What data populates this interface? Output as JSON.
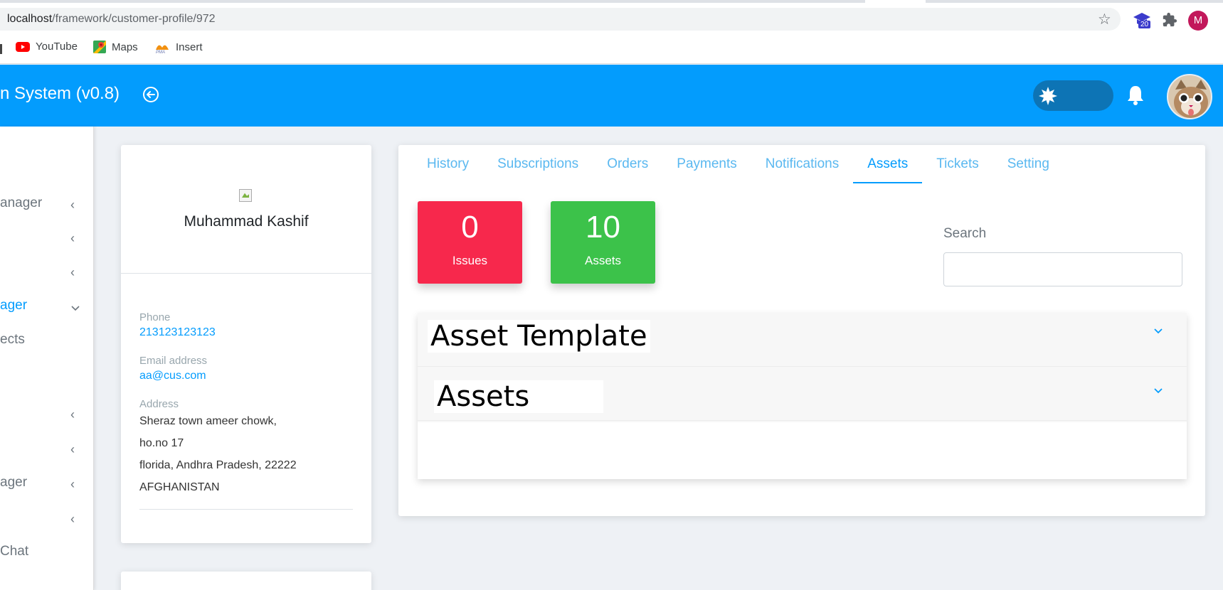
{
  "browser": {
    "url_host": "localhost",
    "url_path": "/framework/customer-profile/972",
    "extension_badge": "20",
    "profile_initial": "M",
    "bookmarks": [
      {
        "label": "YouTube",
        "icon": "youtube-icon"
      },
      {
        "label": "Maps",
        "icon": "maps-icon"
      },
      {
        "label": "Insert",
        "icon": "pma-icon"
      }
    ]
  },
  "header": {
    "title": "n System (v0.8)",
    "accent_color": "#039cfd"
  },
  "sidebar": {
    "items": [
      {
        "label": "anager",
        "chevron": "left"
      },
      {
        "label": "",
        "chevron": "left"
      },
      {
        "label": "",
        "chevron": "left"
      },
      {
        "label": "ager",
        "chevron": "down",
        "active": true
      },
      {
        "label": "ects",
        "chevron": ""
      },
      {
        "label": "",
        "chevron": "left"
      },
      {
        "label": "",
        "chevron": "left"
      },
      {
        "label": "ager",
        "chevron": "left"
      },
      {
        "label": "",
        "chevron": "left"
      },
      {
        "label": " Chat",
        "chevron": ""
      }
    ]
  },
  "profile": {
    "name": "Muhammad Kashif",
    "phone_label": "Phone",
    "phone": "213123123123",
    "email_label": "Email address",
    "email": "aa@cus.com",
    "address_label": "Address",
    "address_lines": [
      "Sheraz town ameer chowk,",
      "ho.no 17",
      "florida, Andhra Pradesh, 22222",
      "AFGHANISTAN"
    ]
  },
  "tabs": [
    {
      "label": "History",
      "active": false
    },
    {
      "label": "Subscriptions",
      "active": false
    },
    {
      "label": "Orders",
      "active": false
    },
    {
      "label": "Payments",
      "active": false
    },
    {
      "label": "Notifications",
      "active": false
    },
    {
      "label": "Assets",
      "active": true
    },
    {
      "label": "Tickets",
      "active": false
    },
    {
      "label": "Setting",
      "active": false
    }
  ],
  "stats": {
    "issues": {
      "value": "0",
      "label": "Issues",
      "color": "#f7284c"
    },
    "assets": {
      "value": "10",
      "label": "Assets",
      "color": "#3cc24a"
    }
  },
  "search": {
    "label": "Search",
    "value": ""
  },
  "accordion": {
    "sections": [
      {
        "title": "Asset Template"
      },
      {
        "title": "Assets"
      }
    ]
  }
}
